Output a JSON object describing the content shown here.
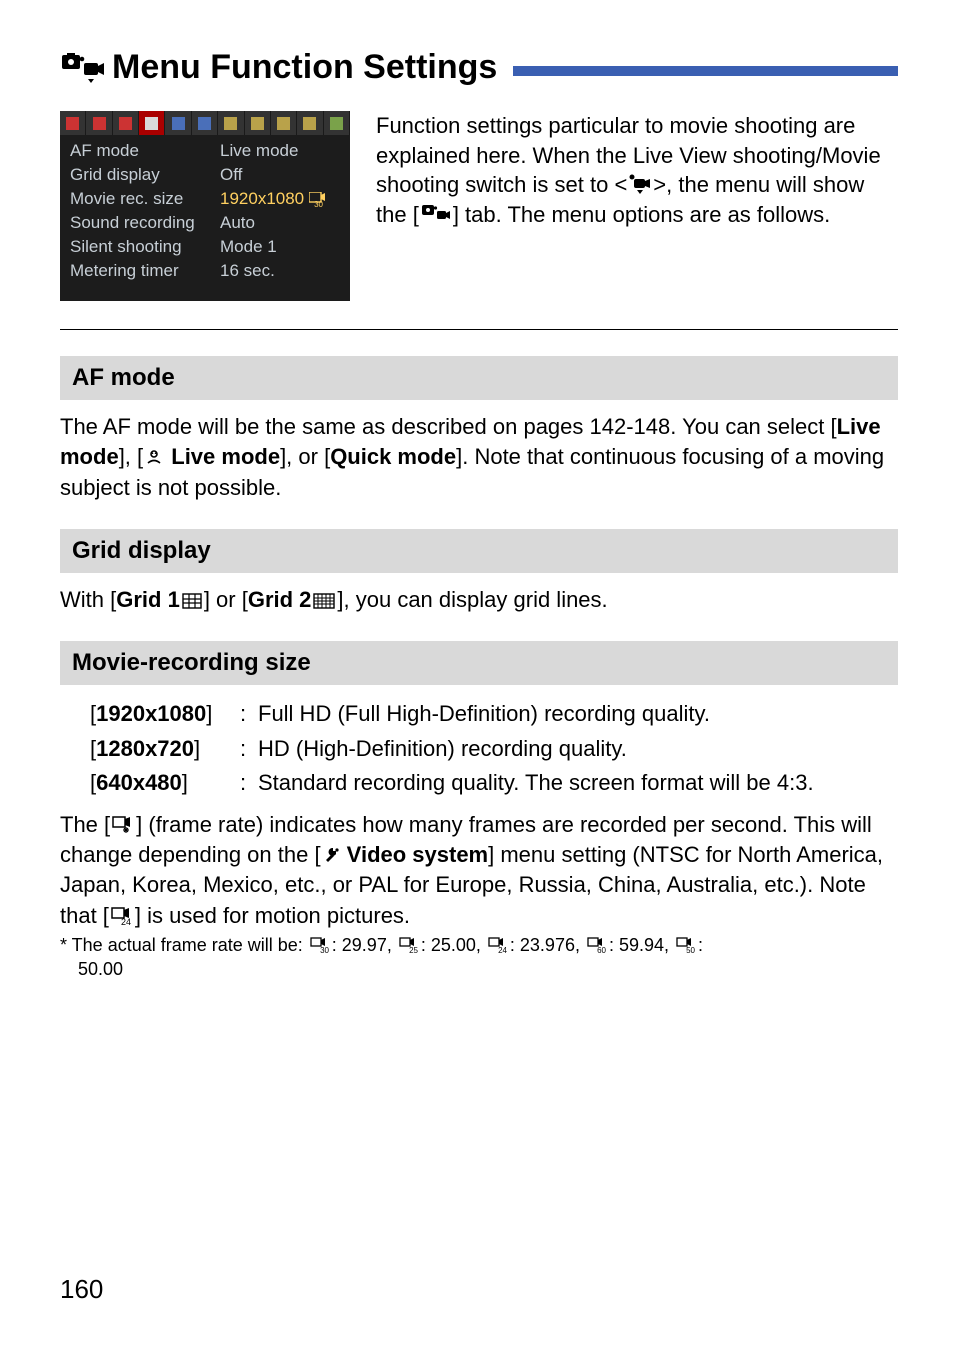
{
  "title": "Menu Function Settings",
  "intro": {
    "menu": {
      "rows": [
        {
          "k": "AF mode",
          "v": "Live mode"
        },
        {
          "k": "Grid display",
          "v": "Off"
        },
        {
          "k": "Movie rec. size",
          "v": "1920x1080 ",
          "framerate_suffix": "30",
          "hl": true
        },
        {
          "k": "Sound recording",
          "v": "Auto"
        },
        {
          "k": "Silent shooting",
          "v": "Mode 1"
        },
        {
          "k": "Metering timer",
          "v": "16 sec."
        }
      ]
    },
    "text_parts": {
      "p1": "Function settings particular to movie shooting are explained here. When the Live View shooting/Movie shooting switch is set to <",
      "p2": ">, the menu will show the [",
      "p3": "] tab. The menu options are as follows."
    }
  },
  "sections": {
    "af": {
      "head": "AF mode",
      "body": {
        "t1": "The AF mode will be the same as described on pages 142-148. You can select [",
        "b1": "Live mode",
        "t2": "], [",
        "b2": " Live mode",
        "t3": "], or [",
        "b3": "Quick mode",
        "t4": "]. Note that continuous focusing of a moving subject is not possible."
      }
    },
    "grid": {
      "head": "Grid display",
      "body": {
        "t1": "With [",
        "b1": "Grid 1",
        "t2": "] or [",
        "b2": "Grid 2",
        "t3": "], you can display grid lines."
      }
    },
    "movie": {
      "head": "Movie-recording size",
      "res": [
        {
          "k": "1920x1080",
          "v": "Full HD (Full High-Definition) recording quality."
        },
        {
          "k": "1280x720",
          "v": "HD (High-Definition) recording quality."
        },
        {
          "k": "640x480",
          "v": "Standard recording quality. The screen format will be 4:3."
        }
      ],
      "framerate": {
        "t1": "The [",
        "t2": "] (frame rate) indicates how many frames are recorded per second. This will change depending on the [",
        "b1": " Video system",
        "t3": "] menu setting (NTSC for North America, Japan, Korea, Mexico, etc., or PAL for Europe, Russia, China, Australia, etc.). Note that [",
        "t4": "] is used for motion pictures."
      },
      "footnote": {
        "lead": "* The actual frame rate will be: ",
        "items": [
          {
            "sub": "30",
            "val": ": 29.97, "
          },
          {
            "sub": "25",
            "val": ": 25.00, "
          },
          {
            "sub": "24",
            "val": ": 23.976, "
          },
          {
            "sub": "60",
            "val": ": 59.94, "
          },
          {
            "sub": "50",
            "val": ": "
          }
        ],
        "trail": "50.00"
      }
    }
  },
  "page_number": "160"
}
